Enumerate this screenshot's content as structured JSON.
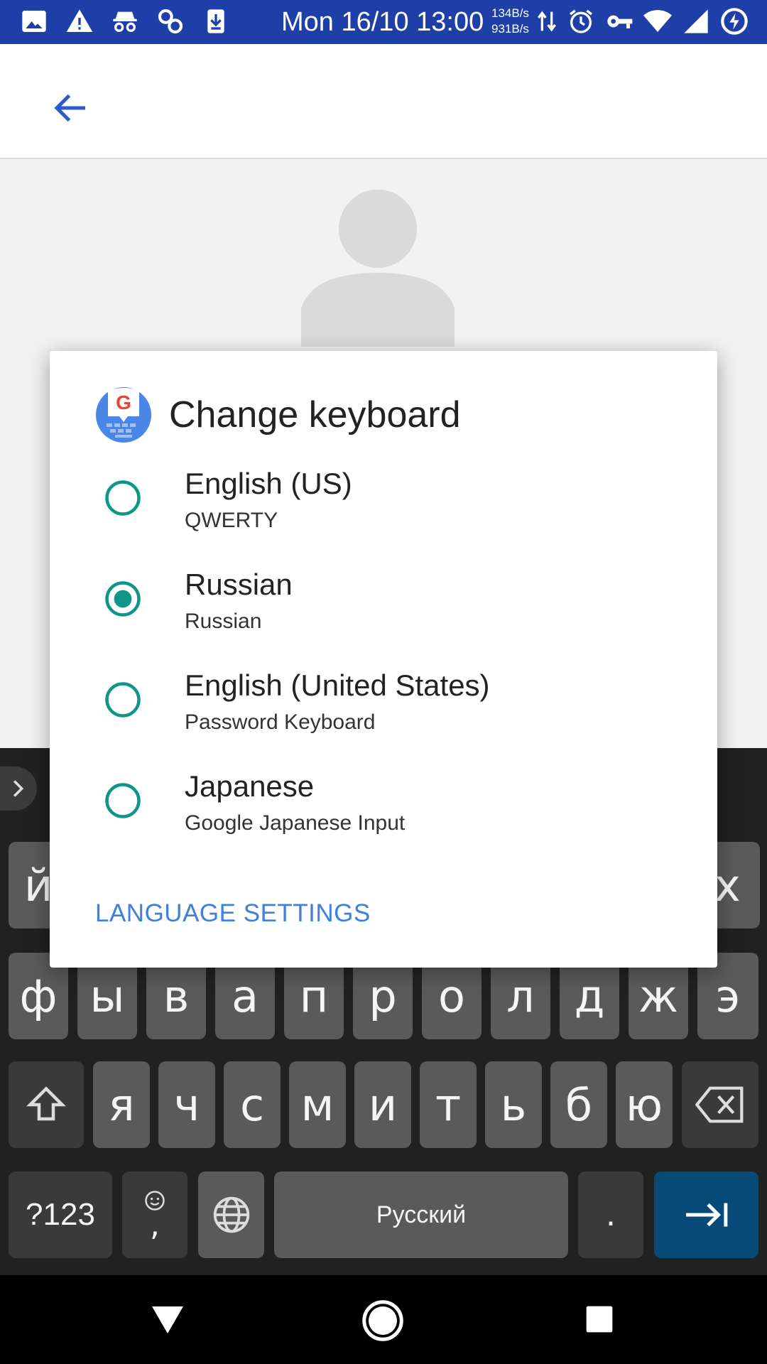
{
  "status_bar": {
    "time": "Mon 16/10 13:00",
    "rate_up": "134B/s",
    "rate_down": "931B/s",
    "icons_left": [
      "image-icon",
      "warning-icon",
      "incognito-icon",
      "link-icon",
      "download-icon"
    ],
    "icons_right": [
      "data-arrows-icon",
      "alarm-icon",
      "vpn-key-icon",
      "wifi-icon",
      "signal-icon",
      "battery-charging-icon"
    ]
  },
  "app_bar": {
    "back_icon": "back-arrow-icon"
  },
  "dialog": {
    "title": "Change keyboard",
    "options": [
      {
        "title": "English (US)",
        "subtitle": "QWERTY",
        "selected": false
      },
      {
        "title": "Russian",
        "subtitle": "Russian",
        "selected": true
      },
      {
        "title": "English (United States)",
        "subtitle": "Password Keyboard",
        "selected": false
      },
      {
        "title": "Japanese",
        "subtitle": "Google Japanese Input",
        "selected": false
      }
    ],
    "language_settings_label": "LANGUAGE SETTINGS"
  },
  "keyboard": {
    "row1_visible": [
      "й",
      "х"
    ],
    "row2": [
      "ф",
      "ы",
      "в",
      "а",
      "п",
      "р",
      "о",
      "л",
      "д",
      "ж",
      "э"
    ],
    "row3": [
      "я",
      "ч",
      "с",
      "м",
      "и",
      "т",
      "ь",
      "б",
      "ю"
    ],
    "symbols_label": "?123",
    "emoji_comma_label": ",",
    "space_label": "Русский",
    "period_label": "."
  },
  "colors": {
    "status_bar": "#1f3fa8",
    "accent_teal": "#0f9688",
    "link_blue": "#3f7fe0",
    "keyboard_bg": "#212121",
    "action_key": "#074a78"
  }
}
